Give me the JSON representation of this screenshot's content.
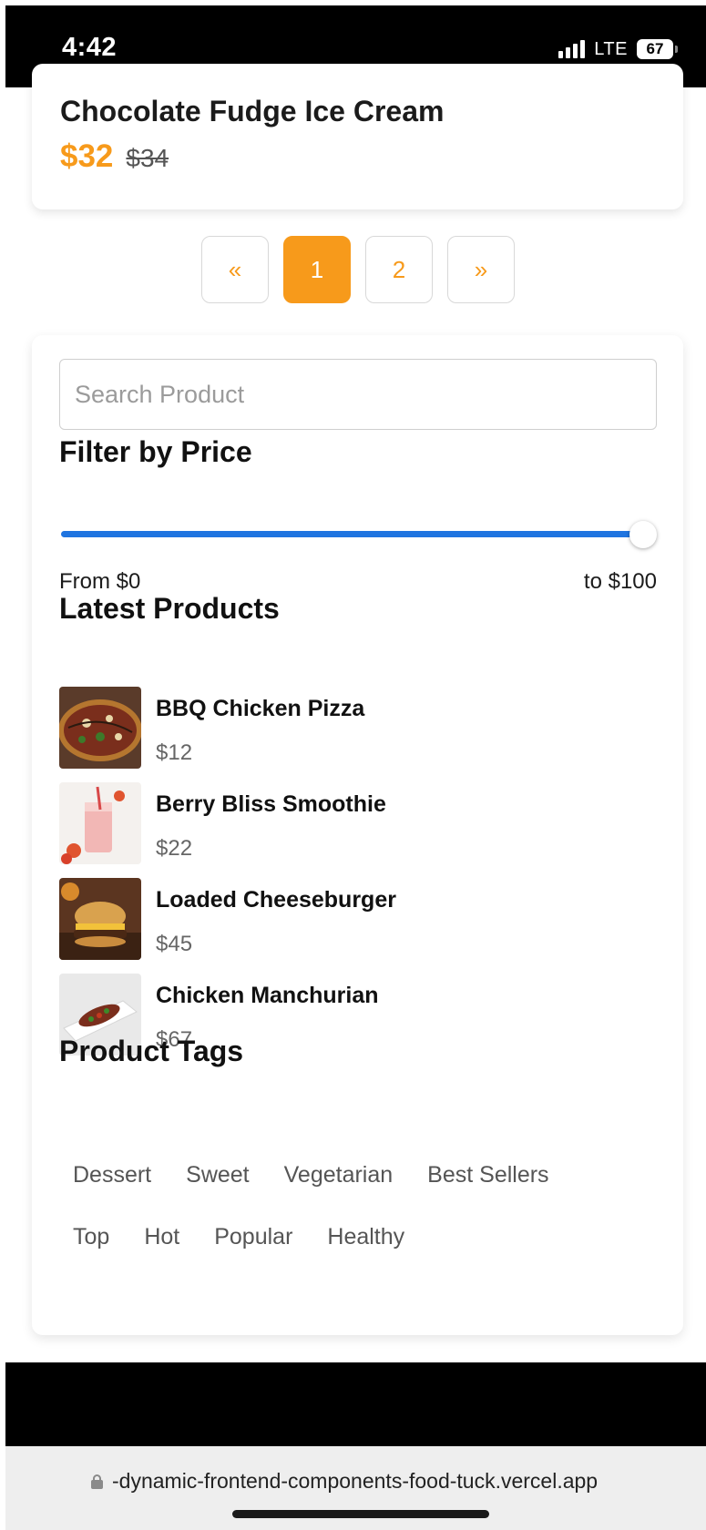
{
  "status_bar": {
    "time": "4:42",
    "network": "LTE",
    "battery": "67"
  },
  "product": {
    "title": "Chocolate Fudge Ice Cream",
    "price": "$32",
    "old_price": "$34"
  },
  "pagination": {
    "prev": "«",
    "pages": [
      "1",
      "2"
    ],
    "active_page": "1",
    "next": "»"
  },
  "colors": {
    "accent": "#f79a1b",
    "slider": "#1f74e0"
  },
  "search": {
    "placeholder": "Search Product",
    "value": ""
  },
  "filter": {
    "title": "Filter by Price",
    "from_label": "From $0",
    "to_label": "to $100",
    "level": 1.0
  },
  "latest": {
    "title": "Latest Products",
    "items": [
      {
        "name": "BBQ Chicken Pizza",
        "price": "$12",
        "image": "pizza"
      },
      {
        "name": "Berry Bliss Smoothie",
        "price": "$22",
        "image": "smoothie"
      },
      {
        "name": "Loaded Cheeseburger",
        "price": "$45",
        "image": "burger"
      },
      {
        "name": "Chicken Manchurian",
        "price": "$67",
        "image": "manchurian"
      }
    ]
  },
  "tags": {
    "title": "Product Tags",
    "items": [
      "Dessert",
      "Sweet",
      "Vegetarian",
      "Best Sellers",
      "Top",
      "Hot",
      "Popular",
      "Healthy"
    ]
  },
  "browser": {
    "url": "-dynamic-frontend-components-food-tuck.vercel.app"
  }
}
